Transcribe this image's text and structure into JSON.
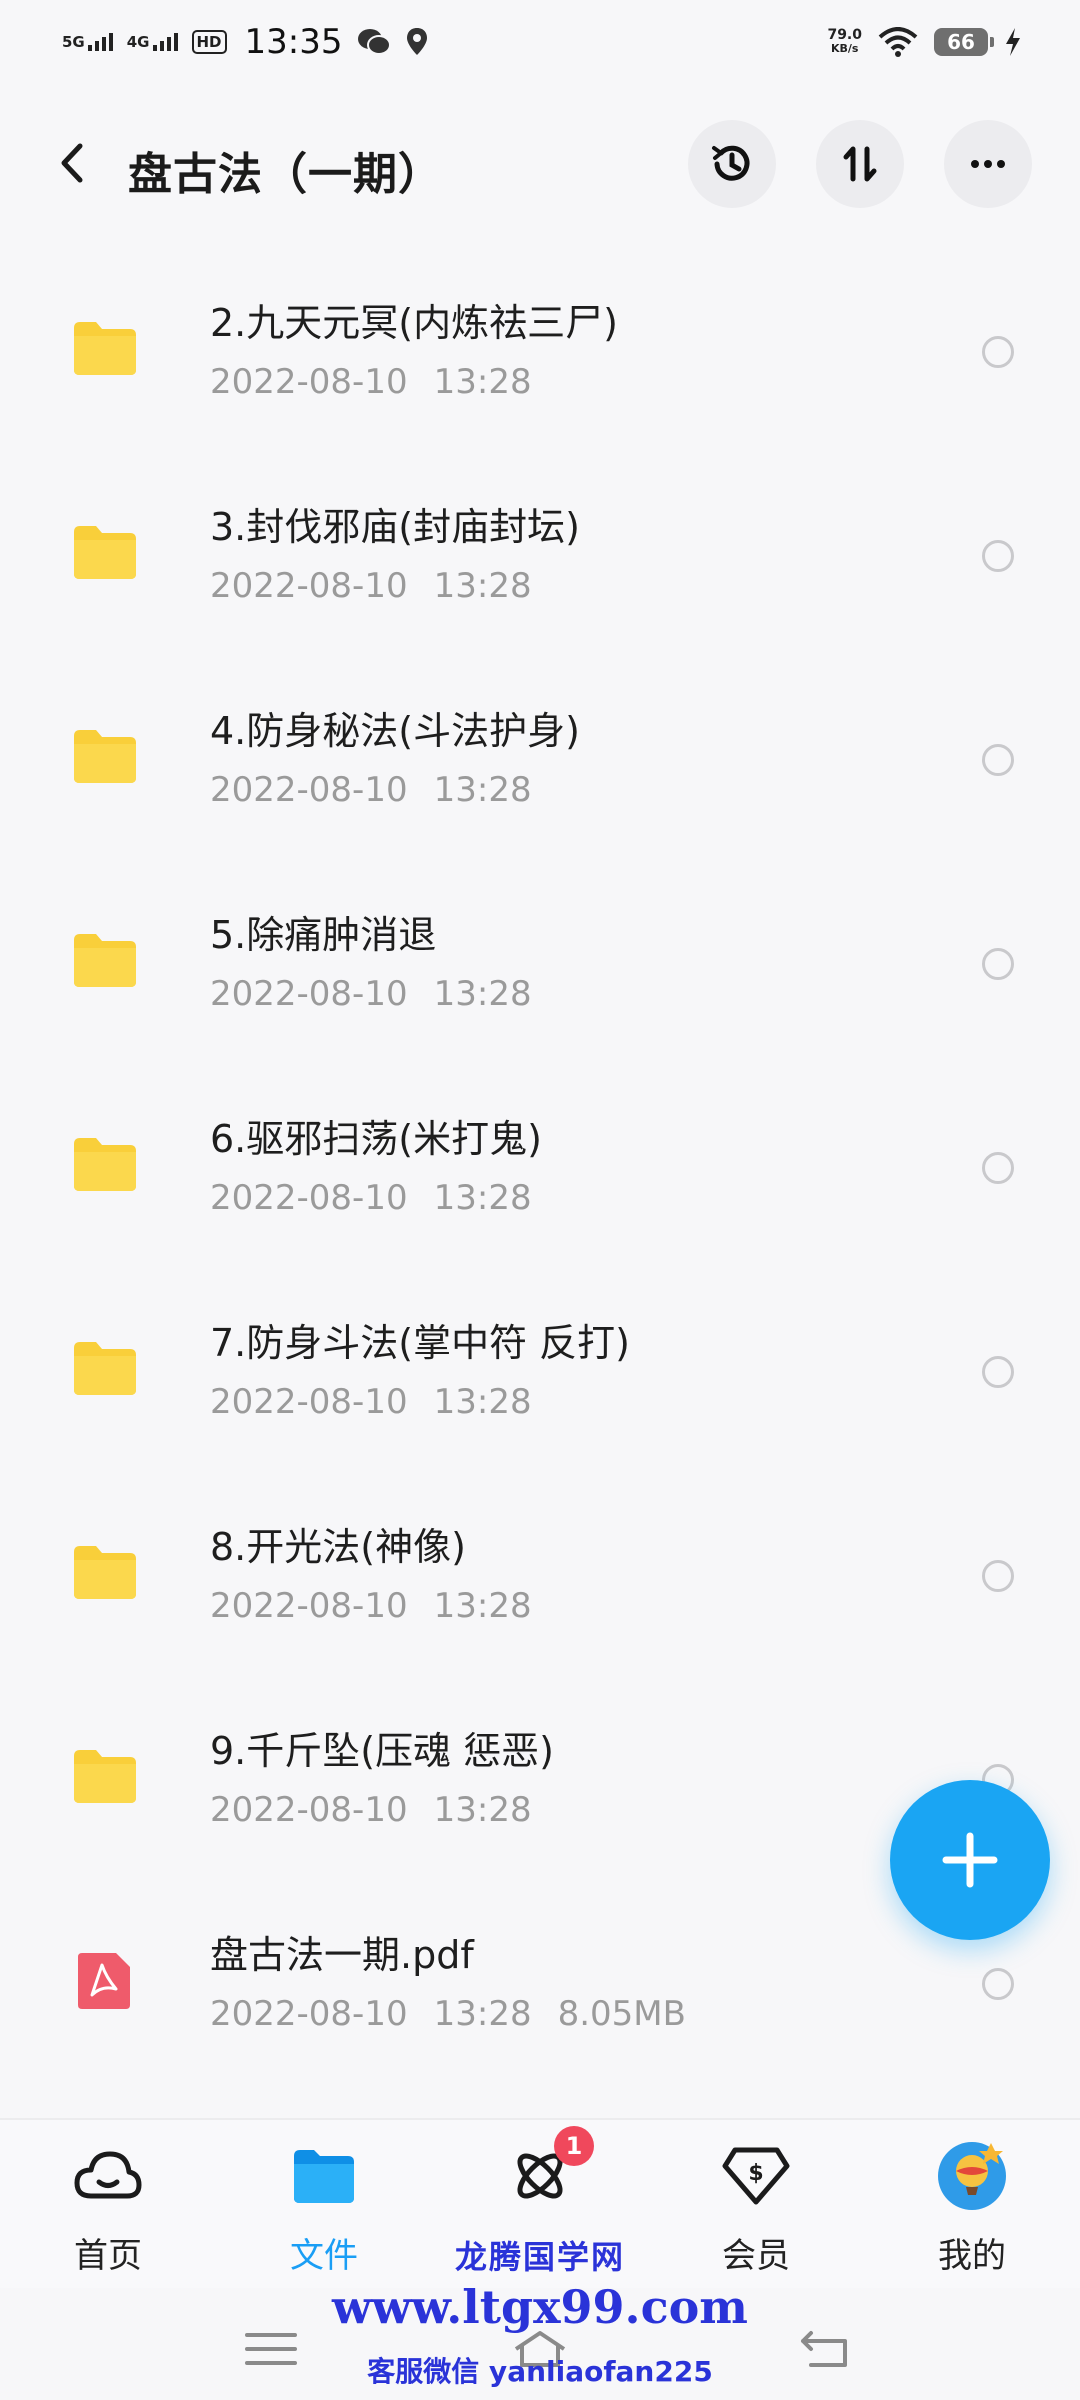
{
  "status_bar": {
    "net1": "5G",
    "net2": "4G",
    "hd": "HD",
    "time": "13:35",
    "speed_value": "79.0",
    "speed_unit": "KB/s",
    "battery": "66"
  },
  "header": {
    "title": "盘古法（一期）",
    "icons": [
      "back-icon",
      "history-icon",
      "sort-icon",
      "more-icon"
    ]
  },
  "files": [
    {
      "name": "2.九天元冥(内炼祛三尸)",
      "date": "2022-08-10",
      "time": "13:28",
      "size": "",
      "type": "folder"
    },
    {
      "name": "3.封伐邪庙(封庙封坛)",
      "date": "2022-08-10",
      "time": "13:28",
      "size": "",
      "type": "folder"
    },
    {
      "name": "4.防身秘法(斗法护身)",
      "date": "2022-08-10",
      "time": "13:28",
      "size": "",
      "type": "folder"
    },
    {
      "name": "5.除痛肿消退",
      "date": "2022-08-10",
      "time": "13:28",
      "size": "",
      "type": "folder"
    },
    {
      "name": "6.驱邪扫荡(米打鬼)",
      "date": "2022-08-10",
      "time": "13:28",
      "size": "",
      "type": "folder"
    },
    {
      "name": "7.防身斗法(掌中符  反打)",
      "date": "2022-08-10",
      "time": "13:28",
      "size": "",
      "type": "folder"
    },
    {
      "name": "8.开光法(神像)",
      "date": "2022-08-10",
      "time": "13:28",
      "size": "",
      "type": "folder"
    },
    {
      "name": "9.千斤坠(压魂  惩恶)",
      "date": "2022-08-10",
      "time": "13:28",
      "size": "",
      "type": "folder"
    },
    {
      "name": "盘古法一期.pdf",
      "date": "2022-08-10",
      "time": "13:28",
      "size": "8.05MB",
      "type": "pdf"
    }
  ],
  "nav": {
    "items": [
      {
        "label": "首页",
        "icon": "cloud-home-icon",
        "active": false
      },
      {
        "label": "文件",
        "icon": "folder-icon",
        "active": true
      },
      {
        "label": "",
        "icon": "atom-icon",
        "badge": "1",
        "active": false
      },
      {
        "label": "会员",
        "icon": "vip-diamond-icon",
        "active": false
      },
      {
        "label": "我的",
        "icon": "avatar-balloon-icon",
        "active": false
      }
    ]
  },
  "watermark": {
    "line1": "龙腾国学网",
    "line2": "www.ltgx99.com",
    "line3": "客服微信 yanliaofan225"
  },
  "colors": {
    "accent": "#1aa5f3",
    "folder": "#f9cf3a",
    "pdf": "#ef5b6b",
    "badge": "#f0485c",
    "watermark": "#2a33d8"
  }
}
